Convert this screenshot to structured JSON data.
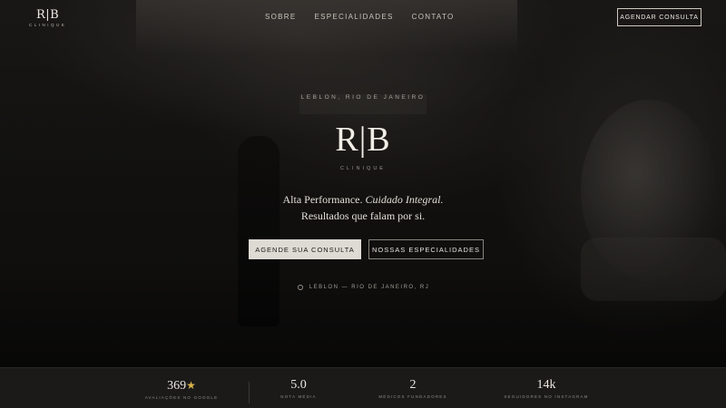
{
  "header": {
    "logo_mark": "R|B",
    "logo_sub": "CLINIQUE",
    "nav": [
      "SOBRE",
      "ESPECIALIDADES",
      "CONTATO"
    ],
    "cta_label": "AGENDAR CONSULTA"
  },
  "hero": {
    "eyebrow": "LEBLON, RIO DE JANEIRO",
    "mark": "R|B",
    "mark_sub": "CLINIQUE",
    "tagline_line1_plain": "Alta Performance.",
    "tagline_line1_italic": "Cuidado Integral.",
    "tagline_line2": "Resultados que falam por si.",
    "primary_button": "AGENDE SUA CONSULTA",
    "secondary_button": "NOSSAS ESPECIALIDADES",
    "location": "LEBLON — RIO DE JANEIRO, RJ",
    "location_icon": "map-pin-icon"
  },
  "stats": [
    {
      "value": "369",
      "label": "AVALIAÇÕES NO GOOGLE",
      "icon": "star-icon"
    },
    {
      "value": "5.0",
      "label": "NOTA MÉDIA"
    },
    {
      "value": "2",
      "label": "MÉDICOS FUNDADORES"
    },
    {
      "value": "14k",
      "label": "SEGUIDORES NO INSTAGRAM"
    }
  ],
  "colors": {
    "background": "#0e0d0c",
    "primary_button": "#dedad4",
    "star": "#d8b24a",
    "stats_bar": "#1b1a19"
  }
}
